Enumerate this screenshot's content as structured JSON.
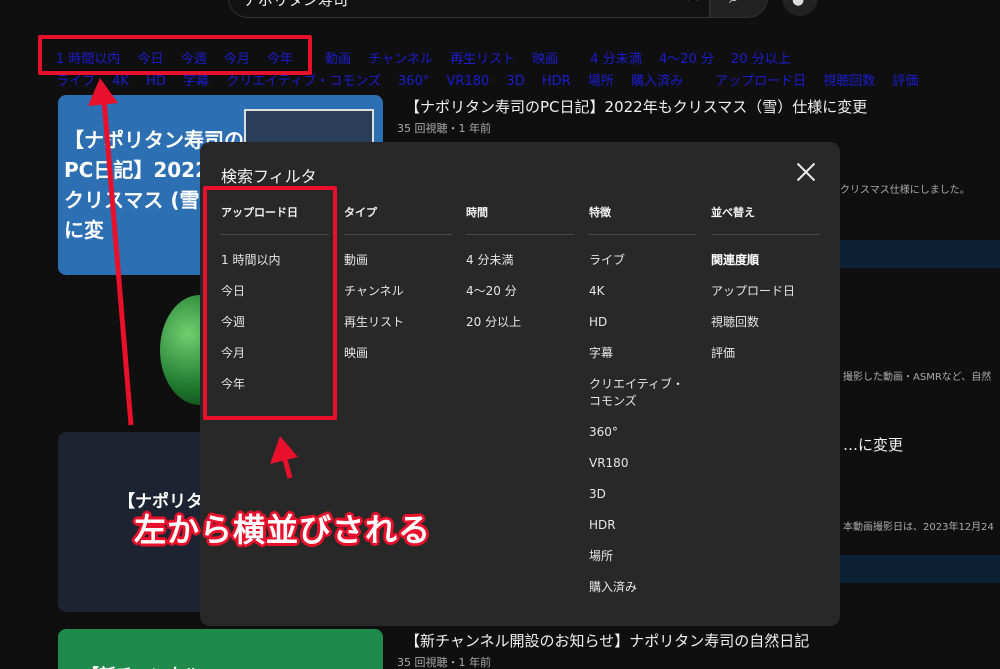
{
  "search": {
    "query": "ナポリタン寿司"
  },
  "filter_rows": {
    "row1": [
      "1 時間以内",
      "今日",
      "今週",
      "今月",
      "今年",
      "動画",
      "チャンネル",
      "再生リスト",
      "映画",
      "4 分未満",
      "4～20 分",
      "20 分以上"
    ],
    "row2": [
      "ライブ",
      "4K",
      "HD",
      "字幕",
      "クリエイティブ・コモンズ",
      "360°",
      "VR180",
      "3D",
      "HDR",
      "場所",
      "購入済み",
      "アップロード日",
      "視聴回数",
      "評価"
    ]
  },
  "videos": [
    {
      "title": "【ナポリタン寿司のPC日記】2022年もクリスマス（雪）仕様に変更",
      "meta": "35 回視聴・1 年前",
      "desc": "…をクリスマス仕様にしました。",
      "thumb_text": "【ナポリタン寿司のPC日記】2022年も クリスマス (雪)仕様に変"
    },
    {
      "title": "",
      "meta": "",
      "desc": "撮影した動画・ASMRなど、自然"
    },
    {
      "title": "…に変更",
      "meta": "",
      "desc": "本動画撮影日は、2023年12月24",
      "thumb_text": "【ナポリタン"
    },
    {
      "title": "【新チャンネル開設のお知らせ】ナポリタン寿司の自然日記",
      "meta": "35 回視聴・1 年前",
      "thumb_text": "【新チャンネル"
    }
  ],
  "dialog": {
    "title": "検索フィルタ",
    "columns": [
      {
        "header": "アップロード日",
        "options": [
          "1 時間以内",
          "今日",
          "今週",
          "今月",
          "今年"
        ]
      },
      {
        "header": "タイプ",
        "options": [
          "動画",
          "チャンネル",
          "再生リスト",
          "映画"
        ]
      },
      {
        "header": "時間",
        "options": [
          "4 分未満",
          "4～20 分",
          "20 分以上"
        ]
      },
      {
        "header": "特徴",
        "options": [
          "ライブ",
          "4K",
          "HD",
          "字幕",
          "クリエイティブ・コモンズ",
          "360°",
          "VR180",
          "3D",
          "HDR",
          "場所",
          "購入済み"
        ]
      },
      {
        "header": "並べ替え",
        "options": [
          "関連度順",
          "アップロード日",
          "視聴回数",
          "評価"
        ],
        "selected": "関連度順"
      }
    ]
  },
  "annotation": {
    "callout": "左から横並びされる",
    "color": "#e8102a"
  }
}
